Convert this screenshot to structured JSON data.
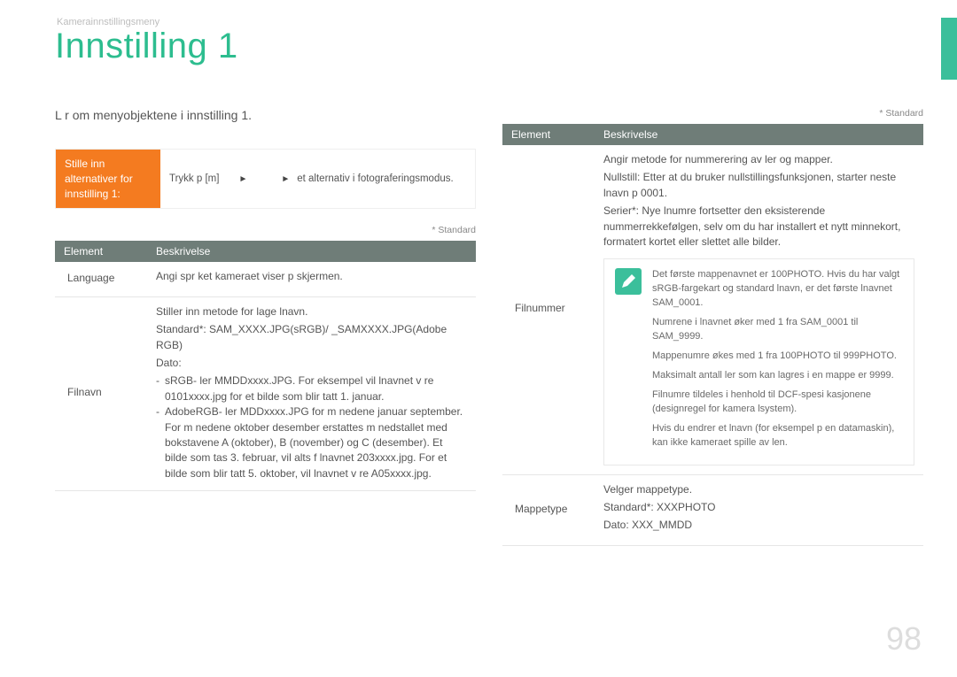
{
  "breadcrumb": "Kamerainnstillingsmeny",
  "title": "Innstilling 1",
  "intro": "L r om menyobjektene i innstilling 1.",
  "instruction": {
    "label": "Stille inn alternativer for innstilling 1:",
    "part1": "Trykk p   [m]",
    "part2": "et alternativ i fotograferingsmodus."
  },
  "standardNote": "* Standard",
  "leftTable": {
    "headers": [
      "Element",
      "Beskrivelse"
    ],
    "rows": [
      {
        "element": "Language",
        "desc": {
          "paras": [
            "Angi spr ket kameraet viser p  skjermen."
          ]
        }
      },
      {
        "element": "Filnavn",
        "desc": {
          "paras": [
            "Stiller inn metode for   lage  lnavn.",
            "Standard*: SAM_XXXX.JPG(sRGB)/ _SAMXXXX.JPG(Adobe RGB)",
            "Dato:"
          ],
          "dashes": [
            "sRGB- ler   MMDDxxxx.JPG. For eksempel vil  lnavnet v re 0101xxxx.jpg for et bilde som blir tatt 1. januar.",
            "AdobeRGB- ler   MDDxxxx.JPG for m nedene januar september. For m nedene oktober desember erstattes m nedstallet med bokstavene A (oktober), B (november) og C (desember). Et bilde som tas 3. februar, vil alts  f   lnavnet 203xxxx.jpg. For et bilde som blir tatt 5. oktober, vil  lnavnet v re A05xxxx.jpg."
          ]
        }
      }
    ]
  },
  "rightTable": {
    "headers": [
      "Element",
      "Beskrivelse"
    ],
    "rows": [
      {
        "element": "Filnummer",
        "desc": {
          "paras": [
            "Angir metode for nummerering av  ler og mapper.",
            "Nullstill: Etter at du bruker nullstillingsfunksjonen, starter neste  lnavn p  0001.",
            "Serier*: Nye  lnumre fortsetter den eksisterende nummerrekkefølgen, selv om du har installert et nytt minnekort, formatert kortet eller slettet alle bilder."
          ],
          "notes": [
            "Det første mappenavnet er 100PHOTO. Hvis du har valgt sRGB-fargekart og standard  lnavn, er det første  lnavnet SAM_0001.",
            "Numrene i  lnavnet øker med 1 fra SAM_0001 til SAM_9999.",
            "Mappenumre økes med 1 fra 100PHOTO til 999PHOTO.",
            "Maksimalt antall  ler som kan lagres i en mappe er 9999.",
            "Filnumre tildeles i henhold til DCF-spesi kasjonene (designregel for kamera  lsystem).",
            "Hvis du endrer et  lnavn (for eksempel p  en datamaskin), kan ikke kameraet spille av  len."
          ]
        }
      },
      {
        "element": "Mappetype",
        "desc": {
          "paras": [
            "Velger mappetype.",
            "Standard*: XXXPHOTO",
            "Dato: XXX_MMDD"
          ]
        }
      }
    ]
  },
  "pageNumber": "98"
}
